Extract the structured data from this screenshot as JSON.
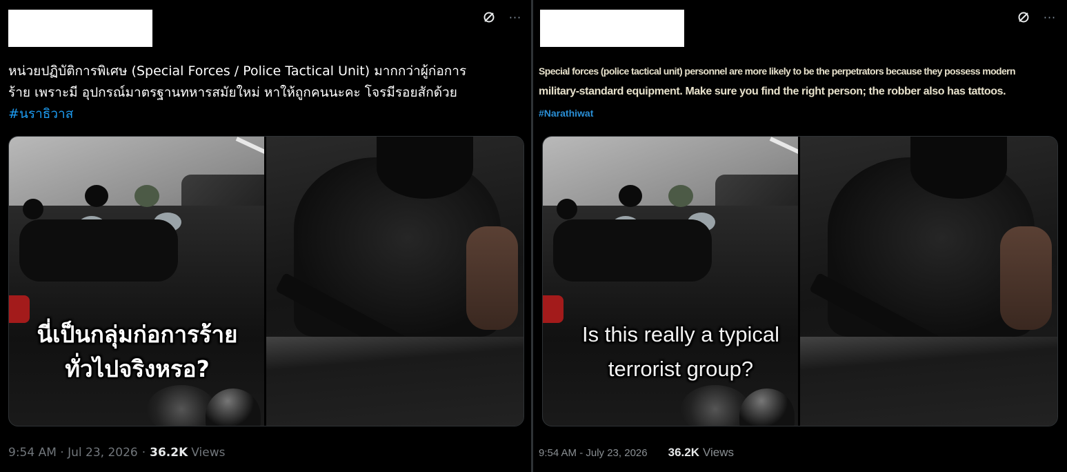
{
  "left_post": {
    "text_line1": "หน่วยปฏิบัติการพิเศษ (Special Forces / Police Tactical Unit) มากกว่าผู้ก่อการ",
    "text_line2": "ร้าย เพราะมี อุปกรณ์มาตรฐานทหารสมัยใหม่ หาให้ถูกคนนะคะ โจรมีรอยสักด้วย",
    "hashtag": "#นราธิวาส",
    "image_caption_line1": "นี่เป็นกลุ่มก่อการร้าย",
    "image_caption_line2": "ทั่วไปจริงหรอ?",
    "timestamp": "9:54 AM · Jul 23, 2026",
    "separator": "·",
    "views_count": "36.2K",
    "views_label": "Views",
    "icons": [
      "no-reply-icon",
      "more-icon"
    ]
  },
  "right_post": {
    "text_line1": "Special forces (police tactical unit) personnel are more likely to be the perpetrators because they possess modern",
    "text_line2": "military-standard equipment. Make sure you find the right person; the robber also has tattoos.",
    "hashtag": "#Narathiwat",
    "image_caption_line1": "Is this really a typical",
    "image_caption_line2": "terrorist group?",
    "timestamp": "9:54 AM - July 23, 2026",
    "views_count": "36.2K",
    "views_label": "Views",
    "icons": [
      "no-reply-icon",
      "more-icon"
    ]
  },
  "colors": {
    "background": "#000000",
    "hashtag": "#1d9bf0",
    "meta_text": "#71767b",
    "redaction": "#ffffff"
  }
}
